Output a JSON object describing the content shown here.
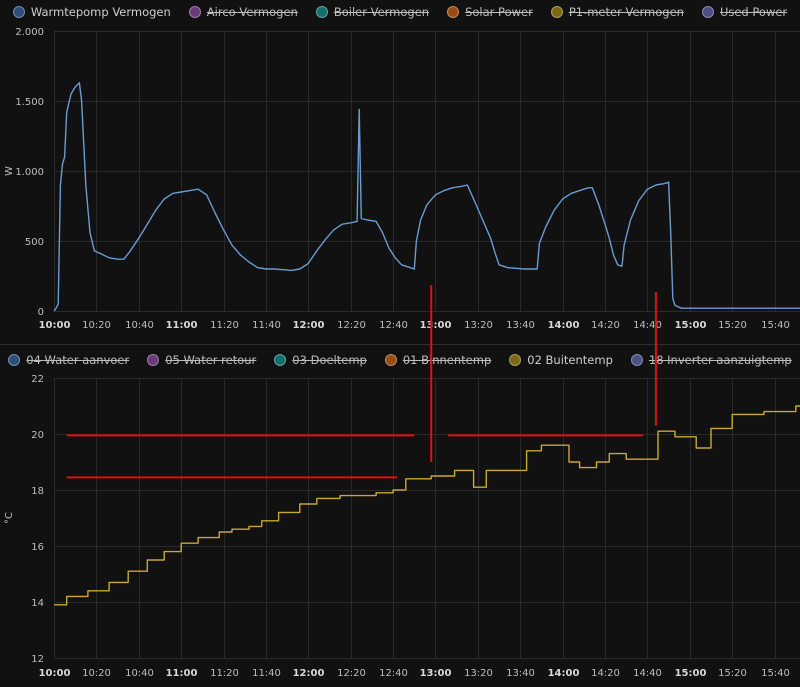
{
  "colors": {
    "background": "#111112",
    "grid": "#2a2a2c",
    "power_line": "#6a9bd1",
    "temp_line": "#c9a832",
    "annotation": "#e01010",
    "divider": "#2f2f31"
  },
  "legend_top": [
    {
      "label": "Warmtepomp Vermogen",
      "color": "#2d4f7a",
      "active": true
    },
    {
      "label": "Airco Vermogen",
      "color": "#6a3a78",
      "active": false
    },
    {
      "label": "Boiler Vermogen",
      "color": "#12706f",
      "active": false
    },
    {
      "label": "Solar Power",
      "color": "#9a4c12",
      "active": false
    },
    {
      "label": "P1-meter Vermogen",
      "color": "#7c6812",
      "active": false
    },
    {
      "label": "Used Power",
      "color": "#4a4f86",
      "active": false
    }
  ],
  "legend_bottom": [
    {
      "label": "04 Water aanvoer",
      "color": "#2d4f7a",
      "active": false
    },
    {
      "label": "05 Water retour",
      "color": "#6a3a78",
      "active": false
    },
    {
      "label": "03 Doeltemp",
      "color": "#12706f",
      "active": false
    },
    {
      "label": "01 Binnentemp",
      "color": "#9a4c12",
      "active": false
    },
    {
      "label": "02 Buitentemp",
      "color": "#7c6812",
      "active": true
    },
    {
      "label": "18 Inverter aanzuigtemp",
      "color": "#4a4f86",
      "active": false
    }
  ],
  "chart_data": [
    {
      "type": "line",
      "ylabel": "W",
      "ylim": [
        0,
        2000
      ],
      "yticks": [
        "0",
        "500",
        "1.000",
        "1.500",
        "2.000"
      ],
      "xlim": [
        "10:00",
        "15:52"
      ],
      "xticks": [
        {
          "t": "10:00",
          "bold": true
        },
        {
          "t": "10:20",
          "bold": false
        },
        {
          "t": "10:40",
          "bold": false
        },
        {
          "t": "11:00",
          "bold": true
        },
        {
          "t": "11:20",
          "bold": false
        },
        {
          "t": "11:40",
          "bold": false
        },
        {
          "t": "12:00",
          "bold": true
        },
        {
          "t": "12:20",
          "bold": false
        },
        {
          "t": "12:40",
          "bold": false
        },
        {
          "t": "13:00",
          "bold": true
        },
        {
          "t": "13:20",
          "bold": false
        },
        {
          "t": "13:40",
          "bold": false
        },
        {
          "t": "14:00",
          "bold": true
        },
        {
          "t": "14:20",
          "bold": false
        },
        {
          "t": "14:40",
          "bold": false
        },
        {
          "t": "15:00",
          "bold": true
        },
        {
          "t": "15:20",
          "bold": false
        },
        {
          "t": "15:40",
          "bold": false
        }
      ],
      "grid": true,
      "series": [
        {
          "name": "Warmtepomp Vermogen",
          "points": [
            [
              "10:00",
              0
            ],
            [
              "10:01",
              20
            ],
            [
              "10:02",
              50
            ],
            [
              "10:03",
              900
            ],
            [
              "10:04",
              1050
            ],
            [
              "10:05",
              1100
            ],
            [
              "10:06",
              1420
            ],
            [
              "10:08",
              1550
            ],
            [
              "10:10",
              1600
            ],
            [
              "10:12",
              1630
            ],
            [
              "10:13",
              1500
            ],
            [
              "10:14",
              1200
            ],
            [
              "10:15",
              900
            ],
            [
              "10:17",
              560
            ],
            [
              "10:19",
              430
            ],
            [
              "10:22",
              410
            ],
            [
              "10:26",
              380
            ],
            [
              "10:30",
              370
            ],
            [
              "10:33",
              370
            ],
            [
              "10:36",
              430
            ],
            [
              "10:40",
              520
            ],
            [
              "10:44",
              620
            ],
            [
              "10:48",
              720
            ],
            [
              "10:52",
              800
            ],
            [
              "10:56",
              840
            ],
            [
              "11:00",
              850
            ],
            [
              "11:04",
              860
            ],
            [
              "11:08",
              870
            ],
            [
              "11:12",
              830
            ],
            [
              "11:16",
              700
            ],
            [
              "11:20",
              580
            ],
            [
              "11:24",
              470
            ],
            [
              "11:28",
              400
            ],
            [
              "11:32",
              350
            ],
            [
              "11:36",
              310
            ],
            [
              "11:40",
              300
            ],
            [
              "11:44",
              300
            ],
            [
              "11:48",
              295
            ],
            [
              "11:52",
              290
            ],
            [
              "11:56",
              300
            ],
            [
              "12:00",
              340
            ],
            [
              "12:04",
              430
            ],
            [
              "12:08",
              510
            ],
            [
              "12:12",
              580
            ],
            [
              "12:16",
              620
            ],
            [
              "12:20",
              630
            ],
            [
              "12:23",
              640
            ],
            [
              "12:24",
              1440
            ],
            [
              "12:25",
              660
            ],
            [
              "12:28",
              650
            ],
            [
              "12:32",
              640
            ],
            [
              "12:35",
              560
            ],
            [
              "12:38",
              450
            ],
            [
              "12:41",
              380
            ],
            [
              "12:44",
              330
            ],
            [
              "12:48",
              310
            ],
            [
              "12:50",
              300
            ],
            [
              "12:51",
              500
            ],
            [
              "12:53",
              650
            ],
            [
              "12:56",
              760
            ],
            [
              "13:00",
              830
            ],
            [
              "13:04",
              860
            ],
            [
              "13:08",
              880
            ],
            [
              "13:12",
              890
            ],
            [
              "13:15",
              900
            ],
            [
              "13:18",
              800
            ],
            [
              "13:22",
              660
            ],
            [
              "13:26",
              520
            ],
            [
              "13:28",
              420
            ],
            [
              "13:30",
              330
            ],
            [
              "13:34",
              310
            ],
            [
              "13:38",
              305
            ],
            [
              "13:42",
              300
            ],
            [
              "13:46",
              300
            ],
            [
              "13:48",
              300
            ],
            [
              "13:49",
              480
            ],
            [
              "13:52",
              600
            ],
            [
              "13:56",
              720
            ],
            [
              "14:00",
              800
            ],
            [
              "14:04",
              840
            ],
            [
              "14:08",
              860
            ],
            [
              "14:12",
              880
            ],
            [
              "14:14",
              880
            ],
            [
              "14:17",
              760
            ],
            [
              "14:20",
              620
            ],
            [
              "14:22",
              520
            ],
            [
              "14:24",
              400
            ],
            [
              "14:26",
              330
            ],
            [
              "14:28",
              320
            ],
            [
              "14:29",
              470
            ],
            [
              "14:32",
              650
            ],
            [
              "14:36",
              790
            ],
            [
              "14:40",
              870
            ],
            [
              "14:44",
              900
            ],
            [
              "14:48",
              910
            ],
            [
              "14:50",
              920
            ],
            [
              "14:51",
              560
            ],
            [
              "14:52",
              90
            ],
            [
              "14:53",
              40
            ],
            [
              "14:56",
              20
            ],
            [
              "15:00",
              20
            ],
            [
              "15:10",
              20
            ],
            [
              "15:20",
              20
            ],
            [
              "15:30",
              20
            ],
            [
              "15:40",
              20
            ],
            [
              "15:52",
              20
            ]
          ]
        }
      ]
    },
    {
      "type": "line",
      "ylabel": "°C",
      "ylim": [
        12,
        22
      ],
      "yticks": [
        "12",
        "14",
        "16",
        "18",
        "20",
        "22"
      ],
      "xlim": [
        "10:00",
        "15:52"
      ],
      "xticks": [
        {
          "t": "10:00",
          "bold": true
        },
        {
          "t": "10:20",
          "bold": false
        },
        {
          "t": "10:40",
          "bold": false
        },
        {
          "t": "11:00",
          "bold": true
        },
        {
          "t": "11:20",
          "bold": false
        },
        {
          "t": "11:40",
          "bold": false
        },
        {
          "t": "12:00",
          "bold": true
        },
        {
          "t": "12:20",
          "bold": false
        },
        {
          "t": "12:40",
          "bold": false
        },
        {
          "t": "13:00",
          "bold": true
        },
        {
          "t": "13:20",
          "bold": false
        },
        {
          "t": "13:40",
          "bold": false
        },
        {
          "t": "14:00",
          "bold": true
        },
        {
          "t": "14:20",
          "bold": false
        },
        {
          "t": "14:40",
          "bold": false
        },
        {
          "t": "15:00",
          "bold": true
        },
        {
          "t": "15:20",
          "bold": false
        },
        {
          "t": "15:40",
          "bold": false
        }
      ],
      "grid": true,
      "series": [
        {
          "name": "02 Buitentemp",
          "step": true,
          "points": [
            [
              "10:00",
              13.9
            ],
            [
              "10:06",
              14.2
            ],
            [
              "10:16",
              14.4
            ],
            [
              "10:26",
              14.7
            ],
            [
              "10:35",
              15.1
            ],
            [
              "10:44",
              15.5
            ],
            [
              "10:52",
              15.8
            ],
            [
              "11:00",
              16.1
            ],
            [
              "11:08",
              16.3
            ],
            [
              "11:14",
              16.3
            ],
            [
              "11:18",
              16.5
            ],
            [
              "11:24",
              16.6
            ],
            [
              "11:32",
              16.7
            ],
            [
              "11:38",
              16.9
            ],
            [
              "11:46",
              17.2
            ],
            [
              "11:56",
              17.5
            ],
            [
              "12:04",
              17.7
            ],
            [
              "12:15",
              17.8
            ],
            [
              "12:24",
              17.8
            ],
            [
              "12:32",
              17.9
            ],
            [
              "12:40",
              18.0
            ],
            [
              "12:46",
              18.4
            ],
            [
              "12:58",
              18.5
            ],
            [
              "13:09",
              18.7
            ],
            [
              "13:18",
              18.1
            ],
            [
              "13:24",
              18.7
            ],
            [
              "13:34",
              18.7
            ],
            [
              "13:43",
              19.4
            ],
            [
              "13:50",
              19.6
            ],
            [
              "13:58",
              19.6
            ],
            [
              "14:03",
              19.0
            ],
            [
              "14:08",
              18.8
            ],
            [
              "14:16",
              19.0
            ],
            [
              "14:22",
              19.3
            ],
            [
              "14:30",
              19.1
            ],
            [
              "14:38",
              19.1
            ],
            [
              "14:45",
              20.1
            ],
            [
              "14:53",
              19.9
            ],
            [
              "15:03",
              19.5
            ],
            [
              "15:10",
              20.2
            ],
            [
              "15:20",
              20.7
            ],
            [
              "15:35",
              20.8
            ],
            [
              "15:50",
              21.0
            ]
          ]
        }
      ]
    }
  ],
  "annotations": [
    {
      "kind": "h",
      "t1": "10:06",
      "t2": "12:50",
      "v": 19.95
    },
    {
      "kind": "h",
      "t1": "10:06",
      "t2": "12:42",
      "v": 18.45
    },
    {
      "kind": "h",
      "t1": "13:06",
      "t2": "14:38",
      "v": 19.95
    },
    {
      "kind": "v",
      "t": "12:58",
      "top_frac": 0.415,
      "v": 19.0
    },
    {
      "kind": "v",
      "t": "14:44",
      "top_frac": 0.425,
      "v": 20.3
    }
  ]
}
